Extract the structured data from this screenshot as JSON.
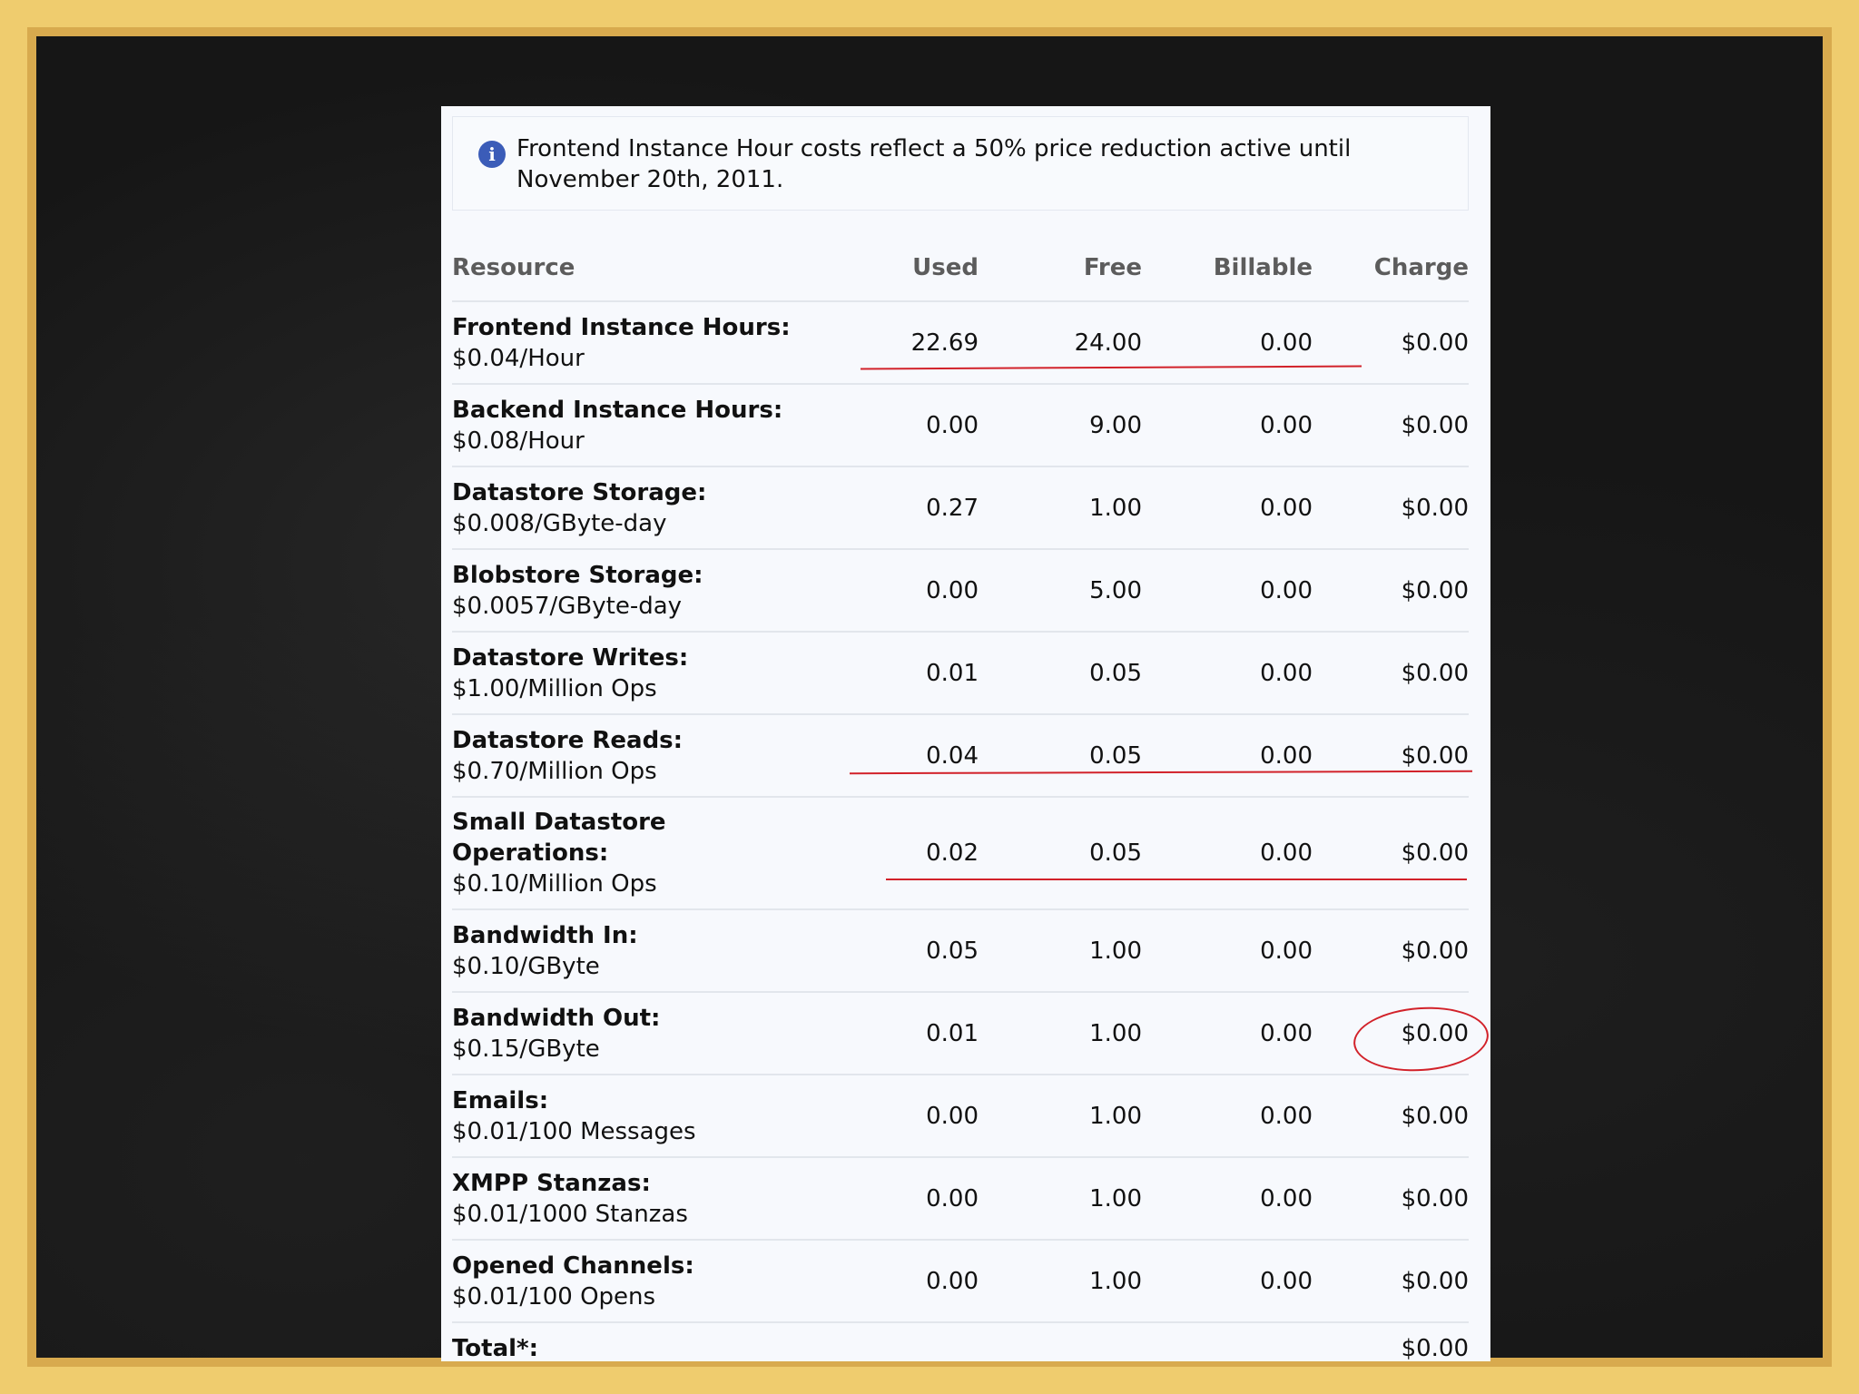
{
  "notice": {
    "icon": "info-icon",
    "text": "Frontend Instance Hour costs reflect a 50% price reduction active until November 20th, 2011."
  },
  "table": {
    "headers": {
      "resource": "Resource",
      "used": "Used",
      "free": "Free",
      "billable": "Billable",
      "charge": "Charge"
    },
    "rows": [
      {
        "name": "Frontend Instance Hours:",
        "price": "$0.04/Hour",
        "used": "22.69",
        "free": "24.00",
        "billable": "0.00",
        "charge": "$0.00"
      },
      {
        "name": "Backend Instance Hours:",
        "price": "$0.08/Hour",
        "used": "0.00",
        "free": "9.00",
        "billable": "0.00",
        "charge": "$0.00"
      },
      {
        "name": "Datastore Storage:",
        "price": "$0.008/GByte-day",
        "used": "0.27",
        "free": "1.00",
        "billable": "0.00",
        "charge": "$0.00"
      },
      {
        "name": "Blobstore Storage:",
        "price": "$0.0057/GByte-day",
        "used": "0.00",
        "free": "5.00",
        "billable": "0.00",
        "charge": "$0.00"
      },
      {
        "name": "Datastore Writes:",
        "price": "$1.00/Million Ops",
        "used": "0.01",
        "free": "0.05",
        "billable": "0.00",
        "charge": "$0.00"
      },
      {
        "name": "Datastore Reads:",
        "price": "$0.70/Million Ops",
        "used": "0.04",
        "free": "0.05",
        "billable": "0.00",
        "charge": "$0.00"
      },
      {
        "name": "Small Datastore Operations:",
        "price": "$0.10/Million Ops",
        "used": "0.02",
        "free": "0.05",
        "billable": "0.00",
        "charge": "$0.00"
      },
      {
        "name": "Bandwidth In:",
        "price": "$0.10/GByte",
        "used": "0.05",
        "free": "1.00",
        "billable": "0.00",
        "charge": "$0.00"
      },
      {
        "name": "Bandwidth Out:",
        "price": "$0.15/GByte",
        "used": "0.01",
        "free": "1.00",
        "billable": "0.00",
        "charge": "$0.00"
      },
      {
        "name": "Emails:",
        "price": "$0.01/100 Messages",
        "used": "0.00",
        "free": "1.00",
        "billable": "0.00",
        "charge": "$0.00"
      },
      {
        "name": "XMPP Stanzas:",
        "price": "$0.01/1000 Stanzas",
        "used": "0.00",
        "free": "1.00",
        "billable": "0.00",
        "charge": "$0.00"
      },
      {
        "name": "Opened Channels:",
        "price": "$0.01/100 Opens",
        "used": "0.00",
        "free": "1.00",
        "billable": "0.00",
        "charge": "$0.00"
      }
    ],
    "total": {
      "label": "Total*:",
      "charge": "$0.00"
    }
  },
  "colors": {
    "annotation_red": "#d2222a",
    "frame_gold": "#efcc6e",
    "board_black": "#161616",
    "info_blue": "#3b5cb8"
  }
}
